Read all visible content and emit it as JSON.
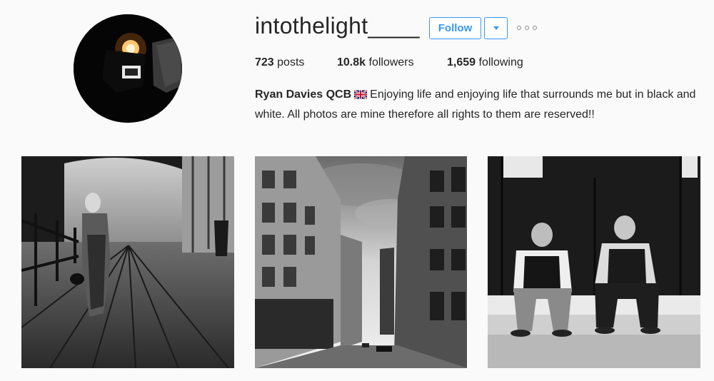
{
  "profile": {
    "username": "intothelight____",
    "follow_label": "Follow",
    "stats": {
      "posts_count": "723",
      "posts_label": "posts",
      "followers_count": "10.8k",
      "followers_label": "followers",
      "following_count": "1,659",
      "following_label": "following"
    },
    "full_name": "Ryan Davies QCB",
    "bio": "Enjoying life and enjoying life that surrounds me but in black and white. All photos are mine therefore all rights to them are reserved!!"
  },
  "colors": {
    "accent": "#3897f0",
    "text": "#262626",
    "background": "#fafafa"
  },
  "icons": {
    "dropdown": "caret-down-icon",
    "more": "more-options-icon",
    "flag": "uk-flag-icon"
  }
}
